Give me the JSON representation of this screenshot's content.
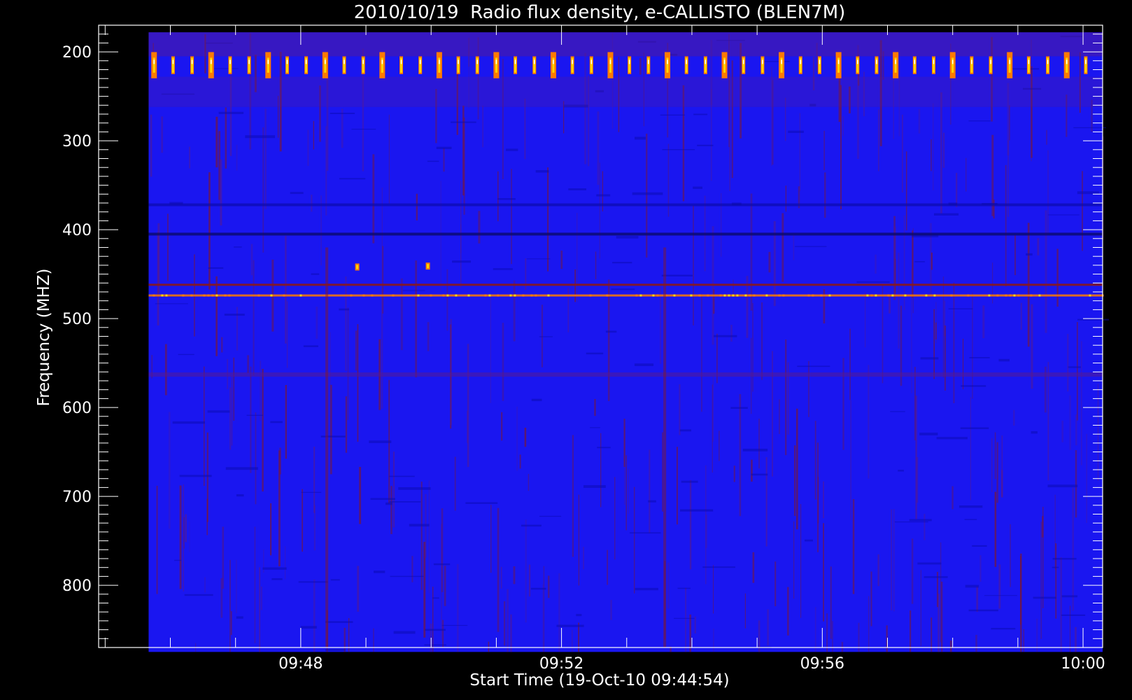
{
  "chart_data": {
    "type": "heatmap",
    "title": "2010/10/19  Radio flux density, e-CALLISTO (BLEN7M)",
    "xlabel": "Start Time (19-Oct-10 09:44:54)",
    "ylabel": "Frequency (MHZ)",
    "x_ticks": [
      "09:48",
      "09:52",
      "09:56",
      "10:00"
    ],
    "y_ticks": [
      200,
      300,
      400,
      500,
      600,
      700,
      800
    ],
    "xlim": [
      "09:44:54",
      "10:00:18"
    ],
    "ylim": [
      170,
      870
    ],
    "data_xlim": [
      "09:45:40",
      "10:00:18"
    ],
    "data_ylim": [
      178,
      875
    ],
    "y_inverted": true,
    "colormap": [
      "#1414ff",
      "#2a10d8",
      "#5a1a8a",
      "#8a1818",
      "#ff7a00",
      "#ffd800",
      "#ffffff"
    ],
    "background_color": "#1a16f0",
    "features": {
      "periodic_bursts": {
        "freq_range_mhz": [
          205,
          225
        ],
        "period_s": 17.5,
        "start": "09:45:45",
        "end": "10:00:05"
      },
      "interference_lines_mhz": [
        405,
        462,
        474,
        563,
        372
      ],
      "brief_spikes": [
        {
          "time": "09:48:52",
          "freq_mhz": 442
        },
        {
          "time": "09:49:57",
          "freq_mhz": 441
        }
      ],
      "vertical_streaks": [
        "09:53:35",
        "09:48:24"
      ]
    }
  }
}
